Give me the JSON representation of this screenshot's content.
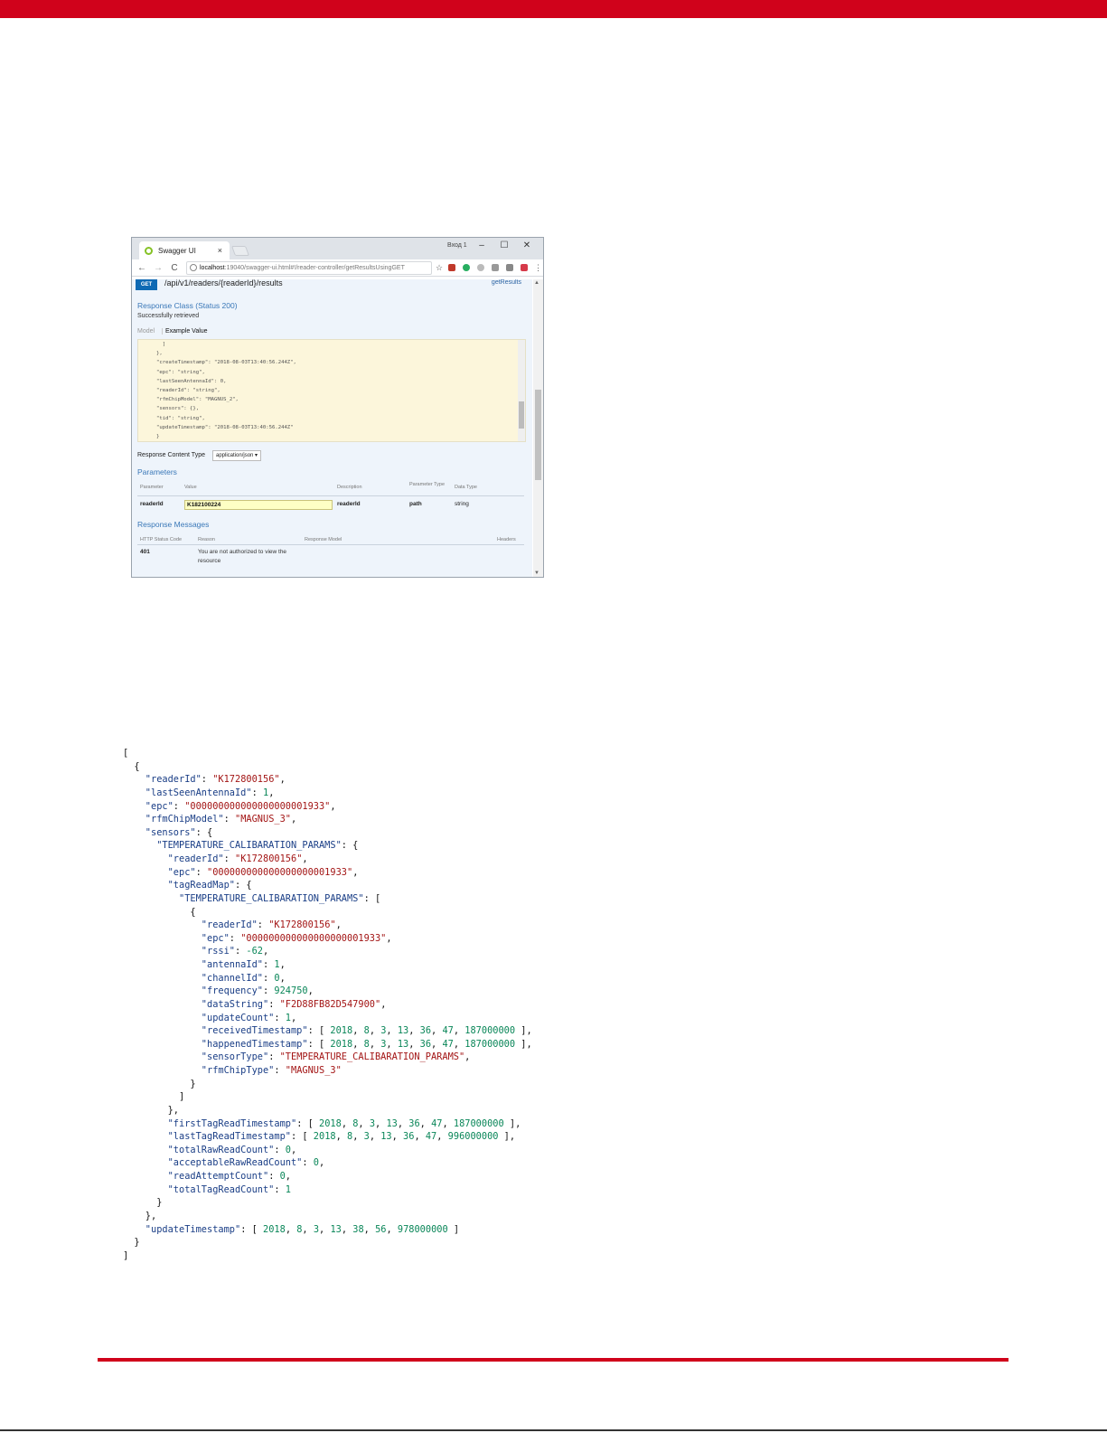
{
  "page": {
    "accent_color": "#d0021b"
  },
  "browser": {
    "tab_title": "Swagger UI",
    "tab_close": "×",
    "user_label": "Вход 1",
    "window_controls": {
      "minimize": "–",
      "maximize": "☐",
      "close": "✕"
    },
    "nav": {
      "back": "←",
      "forward": "→",
      "reload": "C"
    },
    "url_host": "localhost",
    "url_path": ":19040/swagger-ui.html#!/reader-controller/getResultsUsingGET",
    "icons": [
      "info-icon",
      "star-icon",
      "extension-icon"
    ]
  },
  "swagger": {
    "method": "GET",
    "endpoint": "/api/v1/readers/{readerId}/results",
    "operation_id": "getResults",
    "response_class_title": "Response Class (Status 200)",
    "response_class_sub": "Successfully retrieved",
    "tabs": {
      "model": "Model",
      "example": "Example Value"
    },
    "example_lines": [
      "  ]",
      "},",
      "\"createTimestamp\": \"2018-08-03T13:40:56.244Z\",",
      "\"epc\": \"string\",",
      "\"lastSeenAntennaId\": 0,",
      "\"readerId\": \"string\",",
      "\"rfmChipModel\": \"MAGNUS_2\",",
      "\"sensors\": {},",
      "\"tid\": \"string\",",
      "\"updateTimestamp\": \"2018-08-03T13:40:56.244Z\"",
      "}"
    ],
    "response_content_type_label": "Response Content Type",
    "response_content_type_value": "application/json ▾",
    "parameters_title": "Parameters",
    "param_headers": {
      "parameter": "Parameter",
      "value": "Value",
      "description": "Description",
      "parameter_type": "Parameter Type",
      "data_type": "Data Type"
    },
    "param_row": {
      "name": "readerId",
      "value": "K182100224",
      "description": "readerId",
      "type": "path",
      "data_type": "string"
    },
    "response_messages_title": "Response Messages",
    "rm_headers": {
      "status": "HTTP Status Code",
      "reason": "Reason",
      "model": "Response Model",
      "headers": "Headers"
    },
    "rm_row": {
      "status": "401",
      "reason": "You are not authorized to view the resource"
    }
  },
  "json_tokens": [
    {
      "t": "["
    },
    {
      "t": "  {"
    },
    {
      "k": "    \"readerId\"",
      "m": ": ",
      "s": "\"K172800156\"",
      "e": ","
    },
    {
      "k": "    \"lastSeenAntennaId\"",
      "m": ": ",
      "n": "1",
      "e": ","
    },
    {
      "k": "    \"epc\"",
      "m": ": ",
      "s": "\"000000000000000000001933\"",
      "e": ","
    },
    {
      "k": "    \"rfmChipModel\"",
      "m": ": ",
      "s": "\"MAGNUS_3\"",
      "e": ","
    },
    {
      "k": "    \"sensors\"",
      "m": ": {"
    },
    {
      "k": "      \"TEMPERATURE_CALIBARATION_PARAMS\"",
      "m": ": {"
    },
    {
      "k": "        \"readerId\"",
      "m": ": ",
      "s": "\"K172800156\"",
      "e": ","
    },
    {
      "k": "        \"epc\"",
      "m": ": ",
      "s": "\"000000000000000000001933\"",
      "e": ","
    },
    {
      "k": "        \"tagReadMap\"",
      "m": ": {"
    },
    {
      "k": "          \"TEMPERATURE_CALIBARATION_PARAMS\"",
      "m": ": ["
    },
    {
      "t": "            {"
    },
    {
      "k": "              \"readerId\"",
      "m": ": ",
      "s": "\"K172800156\"",
      "e": ","
    },
    {
      "k": "              \"epc\"",
      "m": ": ",
      "s": "\"000000000000000000001933\"",
      "e": ","
    },
    {
      "k": "              \"rssi\"",
      "m": ": ",
      "n": "-62",
      "e": ","
    },
    {
      "k": "              \"antennaId\"",
      "m": ": ",
      "n": "1",
      "e": ","
    },
    {
      "k": "              \"channelId\"",
      "m": ": ",
      "n": "0",
      "e": ","
    },
    {
      "k": "              \"frequency\"",
      "m": ": ",
      "n": "924750",
      "e": ","
    },
    {
      "k": "              \"dataString\"",
      "m": ": ",
      "s": "\"F2D88FB82D547900\"",
      "e": ","
    },
    {
      "k": "              \"updateCount\"",
      "m": ": ",
      "n": "1",
      "e": ","
    },
    {
      "k": "              \"receivedTimestamp\"",
      "m": ": [ ",
      "n": "2018, 8, 3, 13, 36, 47, 187000000",
      "e": " ],"
    },
    {
      "k": "              \"happenedTimestamp\"",
      "m": ": [ ",
      "n": "2018, 8, 3, 13, 36, 47, 187000000",
      "e": " ],"
    },
    {
      "k": "              \"sensorType\"",
      "m": ": ",
      "s": "\"TEMPERATURE_CALIBARATION_PARAMS\"",
      "e": ","
    },
    {
      "k": "              \"rfmChipType\"",
      "m": ": ",
      "s": "\"MAGNUS_3\""
    },
    {
      "t": "            }"
    },
    {
      "t": "          ]"
    },
    {
      "t": "        },"
    },
    {
      "k": "        \"firstTagReadTimestamp\"",
      "m": ": [ ",
      "n": "2018, 8, 3, 13, 36, 47, 187000000",
      "e": " ],"
    },
    {
      "k": "        \"lastTagReadTimestamp\"",
      "m": ": [ ",
      "n": "2018, 8, 3, 13, 36, 47, 996000000",
      "e": " ],"
    },
    {
      "k": "        \"totalRawReadCount\"",
      "m": ": ",
      "n": "0",
      "e": ","
    },
    {
      "k": "        \"acceptableRawReadCount\"",
      "m": ": ",
      "n": "0",
      "e": ","
    },
    {
      "k": "        \"readAttemptCount\"",
      "m": ": ",
      "n": "0",
      "e": ","
    },
    {
      "k": "        \"totalTagReadCount\"",
      "m": ": ",
      "n": "1"
    },
    {
      "t": "      }"
    },
    {
      "t": "    },"
    },
    {
      "k": "    \"updateTimestamp\"",
      "m": ": [ ",
      "n": "2018, 8, 3, 13, 38, 56, 978000000",
      "e": " ]"
    },
    {
      "t": "  }"
    },
    {
      "t": "]"
    }
  ]
}
